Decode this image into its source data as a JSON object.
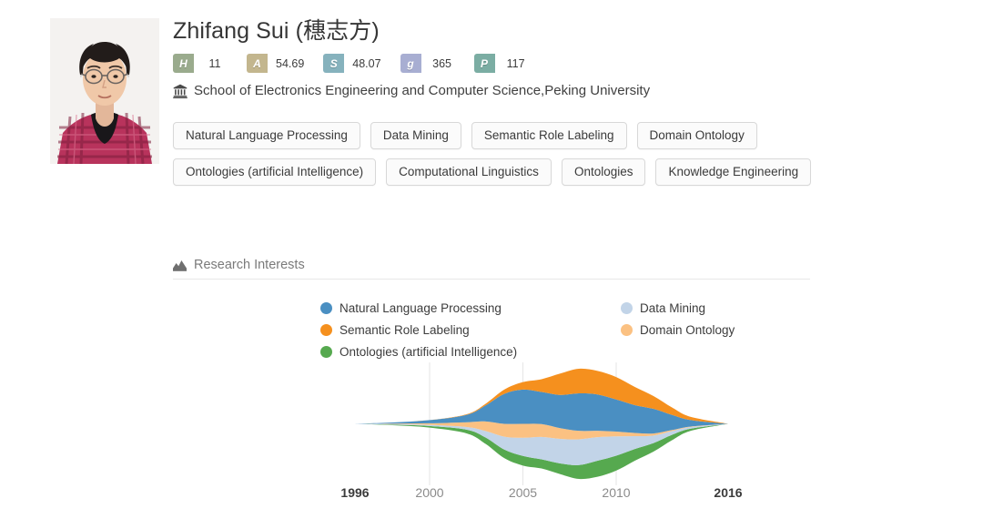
{
  "profile": {
    "photo_alt": "portrait-photo",
    "name": "Zhifang Sui (穗志方)",
    "affiliation": "School of Electronics Engineering and Computer Science,Peking University",
    "affiliation_icon": "bank-icon",
    "badges": [
      {
        "key": "H",
        "label": "H",
        "value": "11",
        "cap_color": "#9aab8d",
        "name": "h-index-badge"
      },
      {
        "key": "A",
        "label": "A",
        "value": "54.69",
        "cap_color": "#c3b68e",
        "name": "activity-badge"
      },
      {
        "key": "S",
        "label": "S",
        "value": "48.07",
        "cap_color": "#86b2bd",
        "name": "sociability-badge"
      },
      {
        "key": "g",
        "label": "g",
        "value": "365",
        "cap_color": "#a8aed2",
        "name": "g-index-badge"
      },
      {
        "key": "P",
        "label": "P",
        "value": "117",
        "cap_color": "#7bada3",
        "name": "publications-badge"
      }
    ],
    "tags_row_1": [
      "Natural Language Processing",
      "Data Mining",
      "Semantic Role Labeling",
      "Domain Ontology"
    ],
    "tags_row_2": [
      "Ontologies (artificial Intelligence)",
      "Computational Linguistics",
      "Ontologies",
      "Knowledge Engineering"
    ]
  },
  "chart_section": {
    "title": "Research Interests",
    "title_icon": "area-chart-icon"
  },
  "chart_data": {
    "type": "area",
    "subtype": "streamgraph",
    "title": "Research Interests",
    "xlabel": "",
    "ylabel": "",
    "grid": true,
    "gridlines_at": [
      2000,
      2005,
      2010
    ],
    "legend_position": "top",
    "xlim": [
      1996,
      2016
    ],
    "x": [
      1996,
      1998,
      2000,
      2002,
      2003,
      2004,
      2005,
      2006,
      2007,
      2008,
      2009,
      2010,
      2011,
      2012,
      2013,
      2014,
      2016
    ],
    "tick_labels": [
      "1996",
      "2000",
      "2005",
      "2010",
      "2016"
    ],
    "tick_values": [
      1996,
      2000,
      2005,
      2010,
      2016
    ],
    "bold_ticks": [
      "1996",
      "2016"
    ],
    "series": [
      {
        "name": "Natural Language Processing",
        "color": "#4a8fc2",
        "values": [
          0,
          0.2,
          0.6,
          1.4,
          3.0,
          5.6,
          6.4,
          6.0,
          6.2,
          7.0,
          6.8,
          6.0,
          5.2,
          4.6,
          2.8,
          1.2,
          0
        ]
      },
      {
        "name": "Data Mining",
        "color": "#c2d4e8",
        "values": [
          0,
          0.1,
          0.2,
          0.5,
          1.2,
          2.4,
          3.4,
          4.2,
          4.6,
          4.8,
          4.4,
          3.6,
          2.4,
          1.4,
          0.7,
          0.3,
          0
        ]
      },
      {
        "name": "Semantic Role Labeling",
        "color": "#f5901e",
        "values": [
          0,
          0,
          0,
          0.1,
          0.3,
          0.8,
          1.4,
          2.4,
          4.0,
          4.6,
          4.4,
          4.2,
          3.4,
          2.4,
          1.4,
          0.6,
          0
        ]
      },
      {
        "name": "Domain Ontology",
        "color": "#fbc182",
        "values": [
          0,
          0.1,
          0.3,
          0.9,
          1.8,
          2.4,
          2.6,
          2.4,
          2.0,
          1.6,
          1.2,
          0.9,
          0.6,
          0.4,
          0.2,
          0.1,
          0
        ]
      },
      {
        "name": "Ontologies (artificial Intelligence)",
        "color": "#56a94f",
        "values": [
          0,
          0.1,
          0.3,
          0.7,
          1.2,
          1.6,
          1.8,
          1.7,
          2.0,
          2.6,
          3.0,
          2.8,
          2.2,
          1.6,
          1.0,
          0.4,
          0
        ]
      }
    ]
  }
}
